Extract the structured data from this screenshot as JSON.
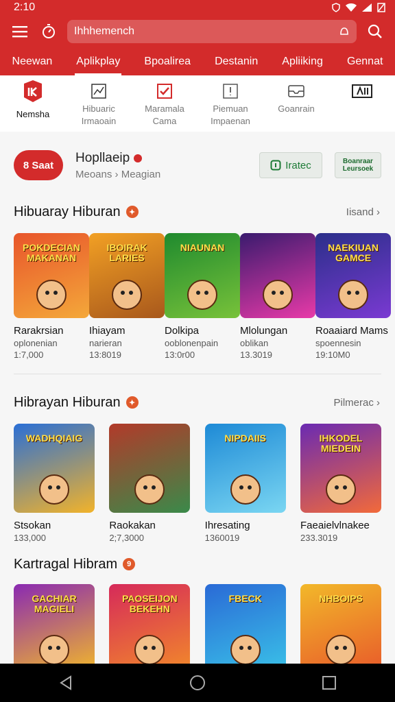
{
  "status": {
    "time": "2:10"
  },
  "search": {
    "placeholder": "Ihhhemench"
  },
  "tabs": [
    {
      "label": "Neewan",
      "active": false
    },
    {
      "label": "Aplikplay",
      "active": true
    },
    {
      "label": "Bpoalirea",
      "active": false
    },
    {
      "label": "Destanin",
      "active": false
    },
    {
      "label": "Apliiking",
      "active": false
    },
    {
      "label": "Gennat",
      "active": false
    }
  ],
  "categories": [
    {
      "line1": "Nemsha",
      "line2": "",
      "icon": "app-logo-icon",
      "active": true
    },
    {
      "line1": "Hibuaric",
      "line2": "Irmaoain",
      "icon": "chart-icon",
      "active": false
    },
    {
      "line1": "Maramala",
      "line2": "Cama",
      "icon": "checkbox-icon",
      "active": false
    },
    {
      "line1": "Piemuan",
      "line2": "Impaenan",
      "icon": "info-icon",
      "active": false
    },
    {
      "line1": "Goanrain",
      "line2": "",
      "icon": "inbox-icon",
      "active": false
    },
    {
      "line1": "",
      "line2": "",
      "icon": "grid-icon",
      "active": false
    }
  ],
  "promo": {
    "pill": "8 Saat",
    "title": "Hopllaeip",
    "subtitle": "Meoans › Meagian",
    "install_label": "Iratec",
    "secondary_label": "Boanraar Leursoek"
  },
  "sections": [
    {
      "title": "Hibuaray Hiburan",
      "badge": "",
      "more": "Iisand ›",
      "items": [
        {
          "title": "Rarakrsian",
          "sub": "oplonenian",
          "num": "1:7,000",
          "art": "POKDECIAN MAKANAN",
          "c1": "#e8552b",
          "c2": "#f4a83a"
        },
        {
          "title": "Ihiayam",
          "sub": "narieran",
          "num": "13:8019",
          "art": "IBOIRAK LARIES",
          "c1": "#f2a024",
          "c2": "#a8581c"
        },
        {
          "title": "Dolkipa",
          "sub": "ooblonenpain",
          "num": "13:0r00",
          "art": "NIAUNAN",
          "c1": "#1f8a2e",
          "c2": "#78c23a"
        },
        {
          "title": "Mlolungan",
          "sub": "oblikan",
          "num": "13.3019",
          "art": "",
          "c1": "#3a1b6e",
          "c2": "#e83aa8"
        },
        {
          "title": "Roaaiard Mams",
          "sub": "spoennesin",
          "num": "19:10M0",
          "art": "NAEKIUAN GAMCE",
          "c1": "#2b2f8a",
          "c2": "#7a3ad2"
        }
      ]
    },
    {
      "title": "Hibrayan Hiburan",
      "badge": "",
      "more": "Pilmerac ›",
      "items": [
        {
          "title": "Stsokan",
          "sub": "",
          "num": "133,000",
          "art": "WADHQIAIG",
          "c1": "#2a6fd6",
          "c2": "#f2b32a"
        },
        {
          "title": "Raokakan",
          "sub": "",
          "num": "2;7,3000",
          "art": "",
          "c1": "#b23a2a",
          "c2": "#3a8a4a"
        },
        {
          "title": "Ihresating",
          "sub": "",
          "num": "1360019",
          "art": "NIPDAIIS",
          "c1": "#1e8ad6",
          "c2": "#7ad6f2"
        },
        {
          "title": "Faeaielvlnakee",
          "sub": "",
          "num": "233.3019",
          "art": "IHKODEL MIEDEIN",
          "c1": "#6a2ab2",
          "c2": "#f26a3a"
        }
      ]
    },
    {
      "title": "Kartragal Hibram",
      "badge": "9",
      "more": "",
      "items": [
        {
          "title": "",
          "sub": "",
          "num": "",
          "art": "GACHIAR MAGIELI",
          "c1": "#8a2ab2",
          "c2": "#f2b82a"
        },
        {
          "title": "",
          "sub": "",
          "num": "",
          "art": "PAOSEIJON BEKEHN",
          "c1": "#d62a5a",
          "c2": "#f28a2a"
        },
        {
          "title": "",
          "sub": "",
          "num": "",
          "art": "FBECK",
          "c1": "#2a6ad6",
          "c2": "#3ac2e8"
        },
        {
          "title": "",
          "sub": "",
          "num": "",
          "art": "NHBOIPS",
          "c1": "#f2b82a",
          "c2": "#e85a2a"
        }
      ]
    }
  ],
  "colors": {
    "brand": "#d32b2b",
    "install_text": "#1c7a35"
  }
}
